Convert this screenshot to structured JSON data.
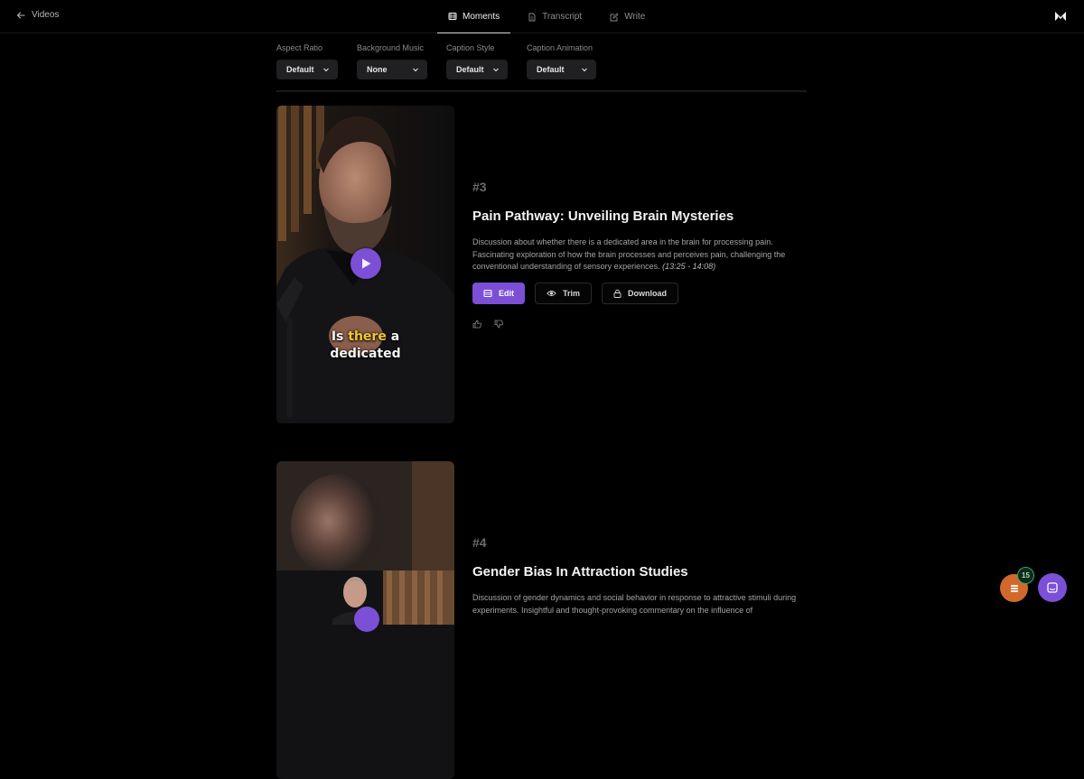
{
  "topbar": {
    "back_label": "Videos",
    "tabs": [
      {
        "label": "Moments",
        "active": true
      },
      {
        "label": "Transcript",
        "active": false
      },
      {
        "label": "Write",
        "active": false
      }
    ]
  },
  "filters": [
    {
      "label": "Aspect Ratio",
      "value": "Default"
    },
    {
      "label": "Background Music",
      "value": "None"
    },
    {
      "label": "Caption Style",
      "value": "Default"
    },
    {
      "label": "Caption Animation",
      "value": "Default"
    }
  ],
  "moments": [
    {
      "number": "#3",
      "title": "Pain Pathway: Unveiling Brain Mysteries",
      "description": "Discussion about whether there is a dedicated area in the brain for processing pain. Fascinating exploration of how the brain processes and perceives pain, challenging the conventional understanding of sensory experiences.",
      "timestamp": "(13:25 - 14:08)",
      "caption_word_1": "Is",
      "caption_highlight": "there",
      "caption_word_2": "a",
      "caption_line_2": "dedicated",
      "actions": {
        "edit": "Edit",
        "trim": "Trim",
        "download": "Download"
      }
    },
    {
      "number": "#4",
      "title": "Gender Bias In Attraction Studies",
      "description": "Discussion of gender dynamics and social behavior in response to attractive stimuli during experiments. Insightful and thought-provoking commentary on the influence of"
    }
  ],
  "floating": {
    "badge_count": "15"
  },
  "colors": {
    "accent": "#7b4fd6",
    "orange": "#d2692a",
    "highlight": "#f1c931"
  }
}
